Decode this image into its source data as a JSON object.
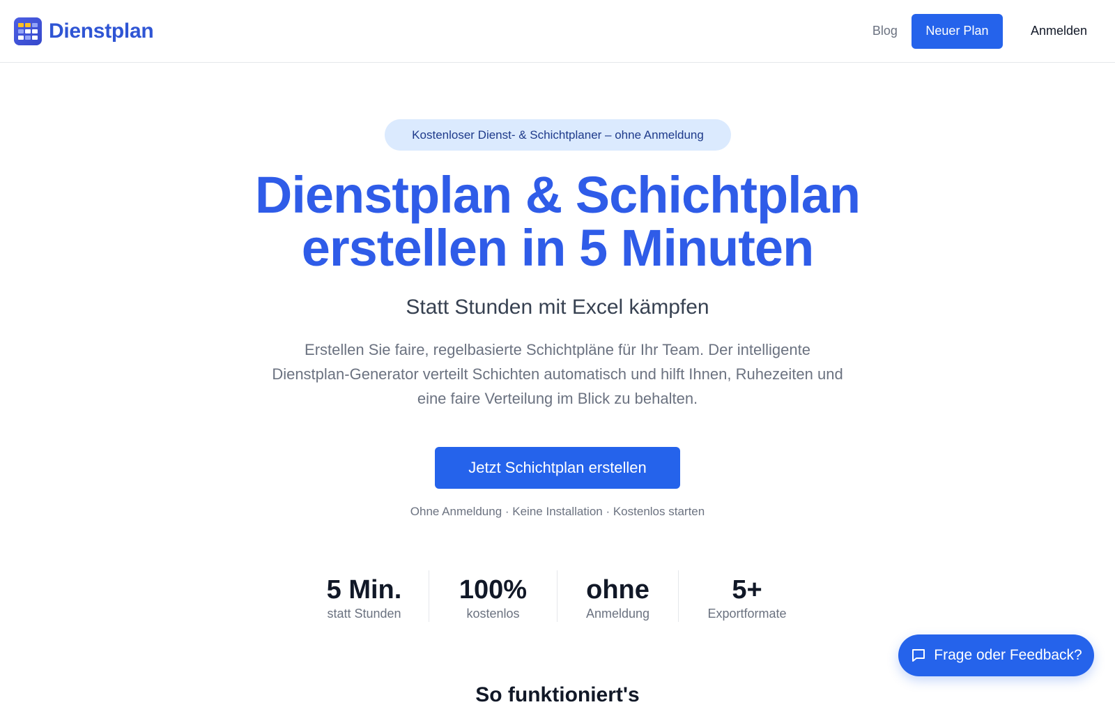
{
  "header": {
    "brand_name": "Dienstplan",
    "nav": {
      "blog": "Blog",
      "new_plan": "Neuer Plan",
      "login": "Anmelden"
    }
  },
  "hero": {
    "badge": "Kostenloser Dienst- & Schichtplaner – ohne Anmeldung",
    "headline_line1": "Dienstplan & Schichtplan",
    "headline_line2": "erstellen in 5 Minuten",
    "subheadline": "Statt Stunden mit Excel kämpfen",
    "description": "Erstellen Sie faire, regelbasierte Schichtpläne für Ihr Team. Der intelligente Dienstplan-Generator verteilt Schichten automatisch und hilft Ihnen, Ruhezeiten und eine faire Verteilung im Blick zu behalten.",
    "cta": "Jetzt Schichtplan erstellen",
    "cta_note": "Ohne Anmeldung · Keine Installation · Kostenlos starten"
  },
  "stats": [
    {
      "value": "5 Min.",
      "label": "statt Stunden"
    },
    {
      "value": "100%",
      "label": "kostenlos"
    },
    {
      "value": "ohne",
      "label": "Anmeldung"
    },
    {
      "value": "5+",
      "label": "Exportformate"
    }
  ],
  "next_section": {
    "title": "So funktioniert's"
  },
  "feedback": {
    "label": "Frage oder Feedback?",
    "icon": "chat-bubble-icon"
  },
  "colors": {
    "primary": "#2563eb",
    "headline": "#2f5ce8",
    "badge_bg": "#dbeafe",
    "badge_text": "#1e3a8a",
    "logo_accent": "#fbbf24"
  }
}
